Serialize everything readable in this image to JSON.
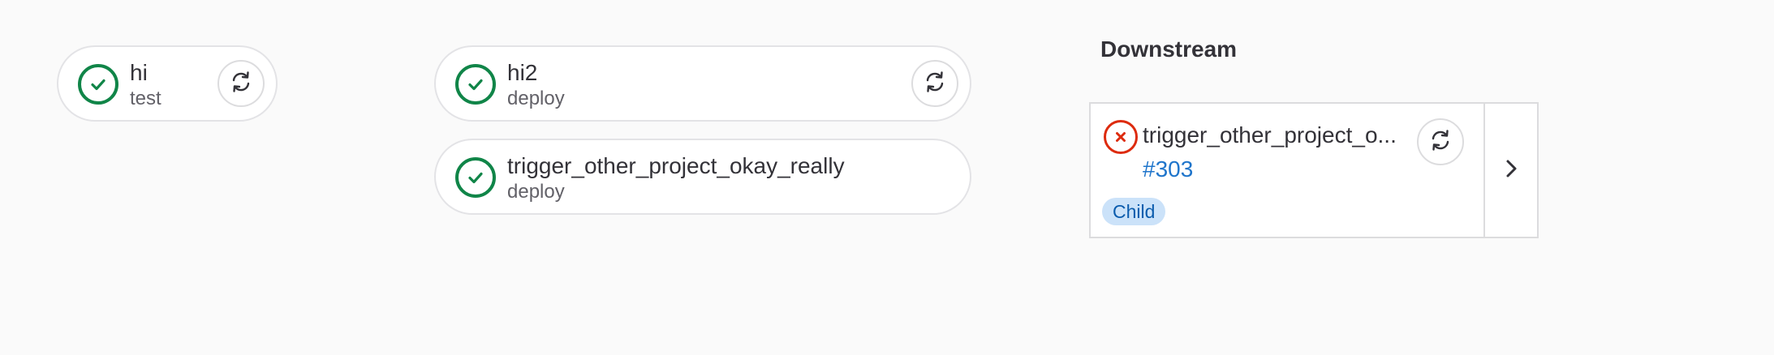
{
  "stages": [
    {
      "jobs": [
        {
          "name": "hi",
          "stage": "test",
          "status": "success",
          "retry_icon": "retry-icon"
        }
      ]
    },
    {
      "jobs": [
        {
          "name": "hi2",
          "stage": "deploy",
          "status": "success",
          "retry_icon": "retry-icon"
        },
        {
          "name": "trigger_other_project_okay_really",
          "stage": "deploy",
          "status": "success"
        }
      ]
    }
  ],
  "downstream": {
    "heading": "Downstream",
    "pipelines": [
      {
        "name": "trigger_other_project_o...",
        "pipeline_id": "#303",
        "badge": "Child",
        "status": "failed",
        "retry_icon": "retry-icon",
        "expand_icon": "chevron-right-icon"
      }
    ]
  },
  "colors": {
    "success": "#108548",
    "failed": "#dd2b0e",
    "link": "#1f75cb",
    "badge_bg": "#cbe2f9",
    "background": "#fafafa"
  }
}
